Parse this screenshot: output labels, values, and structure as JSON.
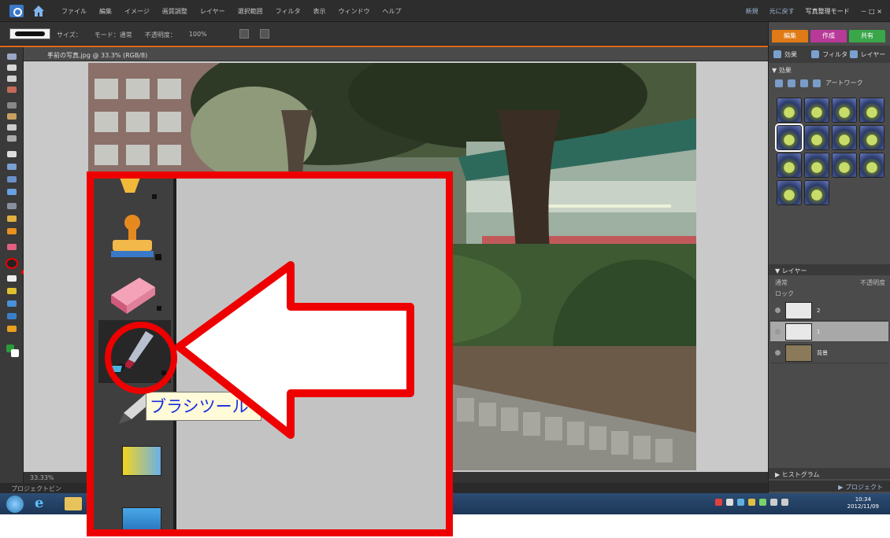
{
  "menubar": {
    "items": [
      "ファイル",
      "編集",
      "イメージ",
      "画質調整",
      "レイヤー",
      "選択範囲",
      "フィルタ",
      "表示",
      "ウィンドウ",
      "ヘルプ"
    ],
    "right": [
      "新規",
      "元に戻す",
      "写真整理モード",
      "－ □ ×"
    ]
  },
  "options": {
    "items": [
      "サイズ：",
      "モード：通常",
      "不透明度：",
      "100%"
    ]
  },
  "document": {
    "title": "手前の写真.jpg @ 33.3% (RGB/8)",
    "status": "33.33%",
    "close": "×"
  },
  "bottom": {
    "label": "プロジェクトビン"
  },
  "right_panel": {
    "mode_tabs": [
      {
        "label": "編集",
        "color": "#e07a16"
      },
      {
        "label": "作成",
        "color": "#b83a98"
      },
      {
        "label": "共有",
        "color": "#3aa64a"
      }
    ],
    "panel_tabs": [
      "効果",
      "フィルタ",
      "レイヤー"
    ],
    "effects_header": "▼ 効果",
    "effects_tool": "アートワーク",
    "layers_header": "▼ レイヤー",
    "layers_blend": "通常",
    "layers_opacity": "不透明度",
    "layers_lock": "ロック",
    "layers": [
      {
        "name": "2",
        "selected": false
      },
      {
        "name": "1",
        "selected": true
      },
      {
        "name": "背景",
        "selected": false
      }
    ],
    "histogram": "▶ ヒストグラム",
    "project_bin": "▶ プロジェクト"
  },
  "taskbar": {
    "ie_glyph": "e",
    "time": "10:34",
    "date": "2012/11/09"
  },
  "callout": {
    "tooltip": "ブラシツール（B）",
    "highlight_color": "#ee0000",
    "tools": [
      "paint-bucket-icon",
      "clone-stamp-icon",
      "eraser-icon",
      "brush-icon",
      "pencil-icon",
      "gradient-icon",
      "shape-icon"
    ]
  }
}
